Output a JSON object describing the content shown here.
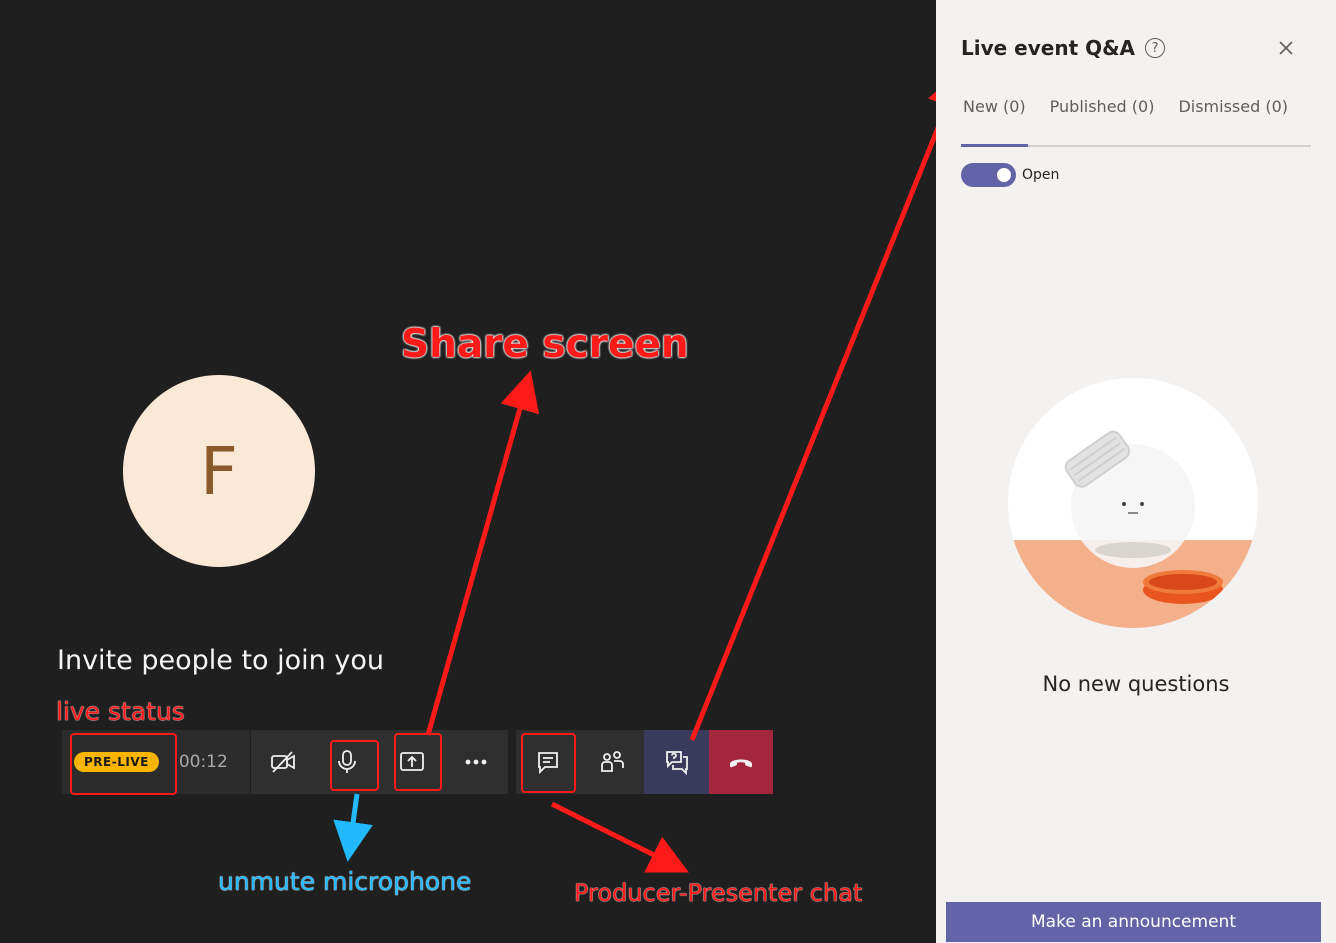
{
  "stage": {
    "avatar_initial": "F",
    "invite_text": "Invite people to join you"
  },
  "callbar": {
    "status_badge": "PRE-LIVE",
    "timer": "00:12",
    "buttons": [
      {
        "name": "camera-off",
        "icon": "video-off-icon"
      },
      {
        "name": "microphone",
        "icon": "microphone-icon"
      },
      {
        "name": "share-screen",
        "icon": "share-screen-icon"
      },
      {
        "name": "more-actions",
        "icon": "more-icon"
      },
      {
        "name": "chat",
        "icon": "chat-icon"
      },
      {
        "name": "participants",
        "icon": "participants-icon"
      },
      {
        "name": "qa",
        "icon": "qa-icon"
      },
      {
        "name": "hang-up",
        "icon": "hang-up-icon"
      }
    ]
  },
  "annotations": {
    "share_screen": "Share screen",
    "live_status": "live status",
    "unmute_microphone": "unmute microphone",
    "producer_chat": "Producer-Presenter chat"
  },
  "panel": {
    "title": "Live event Q&A",
    "help_icon": "?",
    "tabs": [
      {
        "label": "New (0)",
        "active": true
      },
      {
        "label": "Published (0)",
        "active": false
      },
      {
        "label": "Dismissed (0)",
        "active": false
      }
    ],
    "toggle_label": "Open",
    "empty_message": "No new questions",
    "announce_button": "Make an announcement"
  },
  "colors": {
    "stage_bg": "#1f1f1f",
    "accent": "#6264a7",
    "badge": "#f7b500",
    "hangup": "#a4263c",
    "annotation_red": "#ff1a1a",
    "annotation_blue": "#22b9ff"
  }
}
